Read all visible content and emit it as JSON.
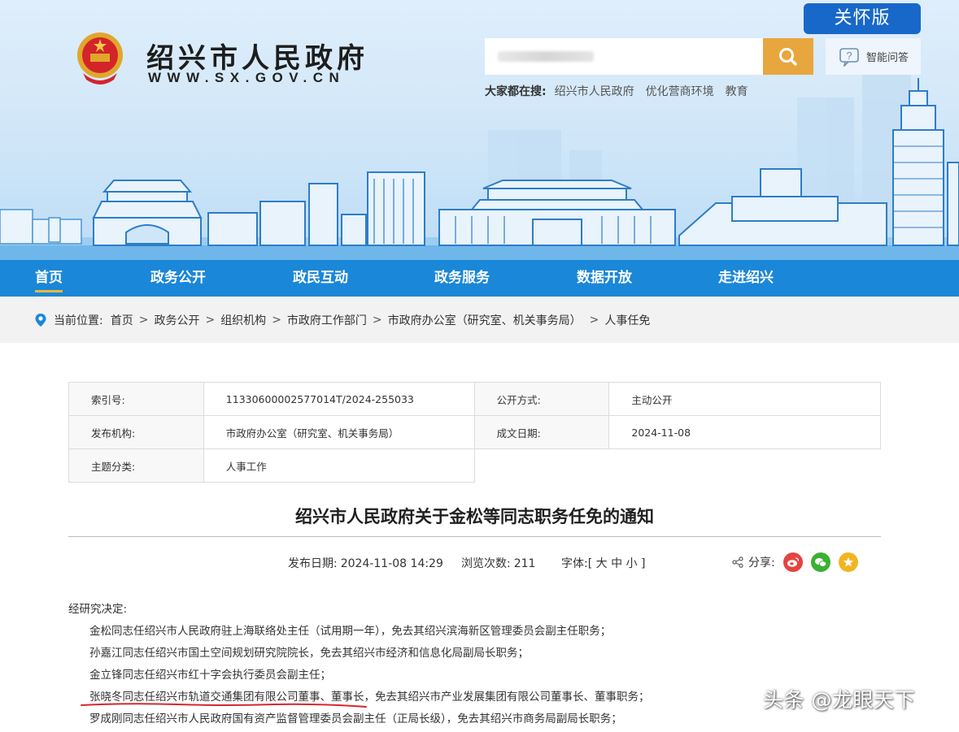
{
  "header": {
    "site_title": "绍兴市人民政府",
    "site_url": "WWW.SX.GOV.CN",
    "care_label": "关怀版",
    "search_placeholder": "",
    "qa_label": "智能问答",
    "hot_search_label": "大家都在搜:",
    "hot_search_items": [
      "绍兴市人民政府",
      "优化营商环境",
      "教育"
    ]
  },
  "nav": {
    "items": [
      "首页",
      "政务公开",
      "政民互动",
      "政务服务",
      "数据开放",
      "走进绍兴"
    ],
    "active_index": 0
  },
  "breadcrumb": {
    "label": "当前位置:",
    "items": [
      "首页",
      "政务公开",
      "组织机构",
      "市政府工作部门",
      "市政府办公室（研究室、机关事务局）",
      "人事任免"
    ]
  },
  "meta": {
    "index_no_label": "索引号:",
    "index_no": "11330600002577014T/2024-255033",
    "public_mode_label": "公开方式:",
    "public_mode": "主动公开",
    "publisher_label": "发布机构:",
    "publisher": "市政府办公室（研究室、机关事务局）",
    "doc_date_label": "成文日期:",
    "doc_date": "2024-11-08",
    "topic_label": "主题分类:",
    "topic": "人事工作"
  },
  "article": {
    "title": "绍兴市人民政府关于金松等同志职务任免的通知",
    "publish_date_label": "发布日期:",
    "publish_date": "2024-11-08 14:29",
    "views_label": "浏览次数:",
    "views": "211",
    "font_label": "字体:[ 大 中 小 ]",
    "share_label": "分享:",
    "intro": "经研究决定:",
    "paragraphs": [
      "金松同志任绍兴市人民政府驻上海联络处主任（试用期一年），免去其绍兴滨海新区管理委员会副主任职务；",
      "孙嘉江同志任绍兴市国土空间规划研究院院长，免去其绍兴市经济和信息化局副局长职务；",
      "金立锋同志任绍兴市红十字会执行委员会副主任；",
      "张晓冬同志任绍兴市轨道交通集团有限公司董事、董事长，免去其绍兴市产业发展集团有限公司董事长、董事职务；",
      "罗成刚同志任绍兴市人民政府国有资产监督管理委员会副主任（正局长级），免去其绍兴市商务局副局长职务；"
    ]
  },
  "watermark": "头条 @龙眼天下",
  "colors": {
    "nav_bg": "#1a87d8",
    "care_bg": "#1868c9",
    "search_btn": "#e8a63f",
    "nav_active_underline": "#f6b73c",
    "mark_red": "#d8262b"
  }
}
